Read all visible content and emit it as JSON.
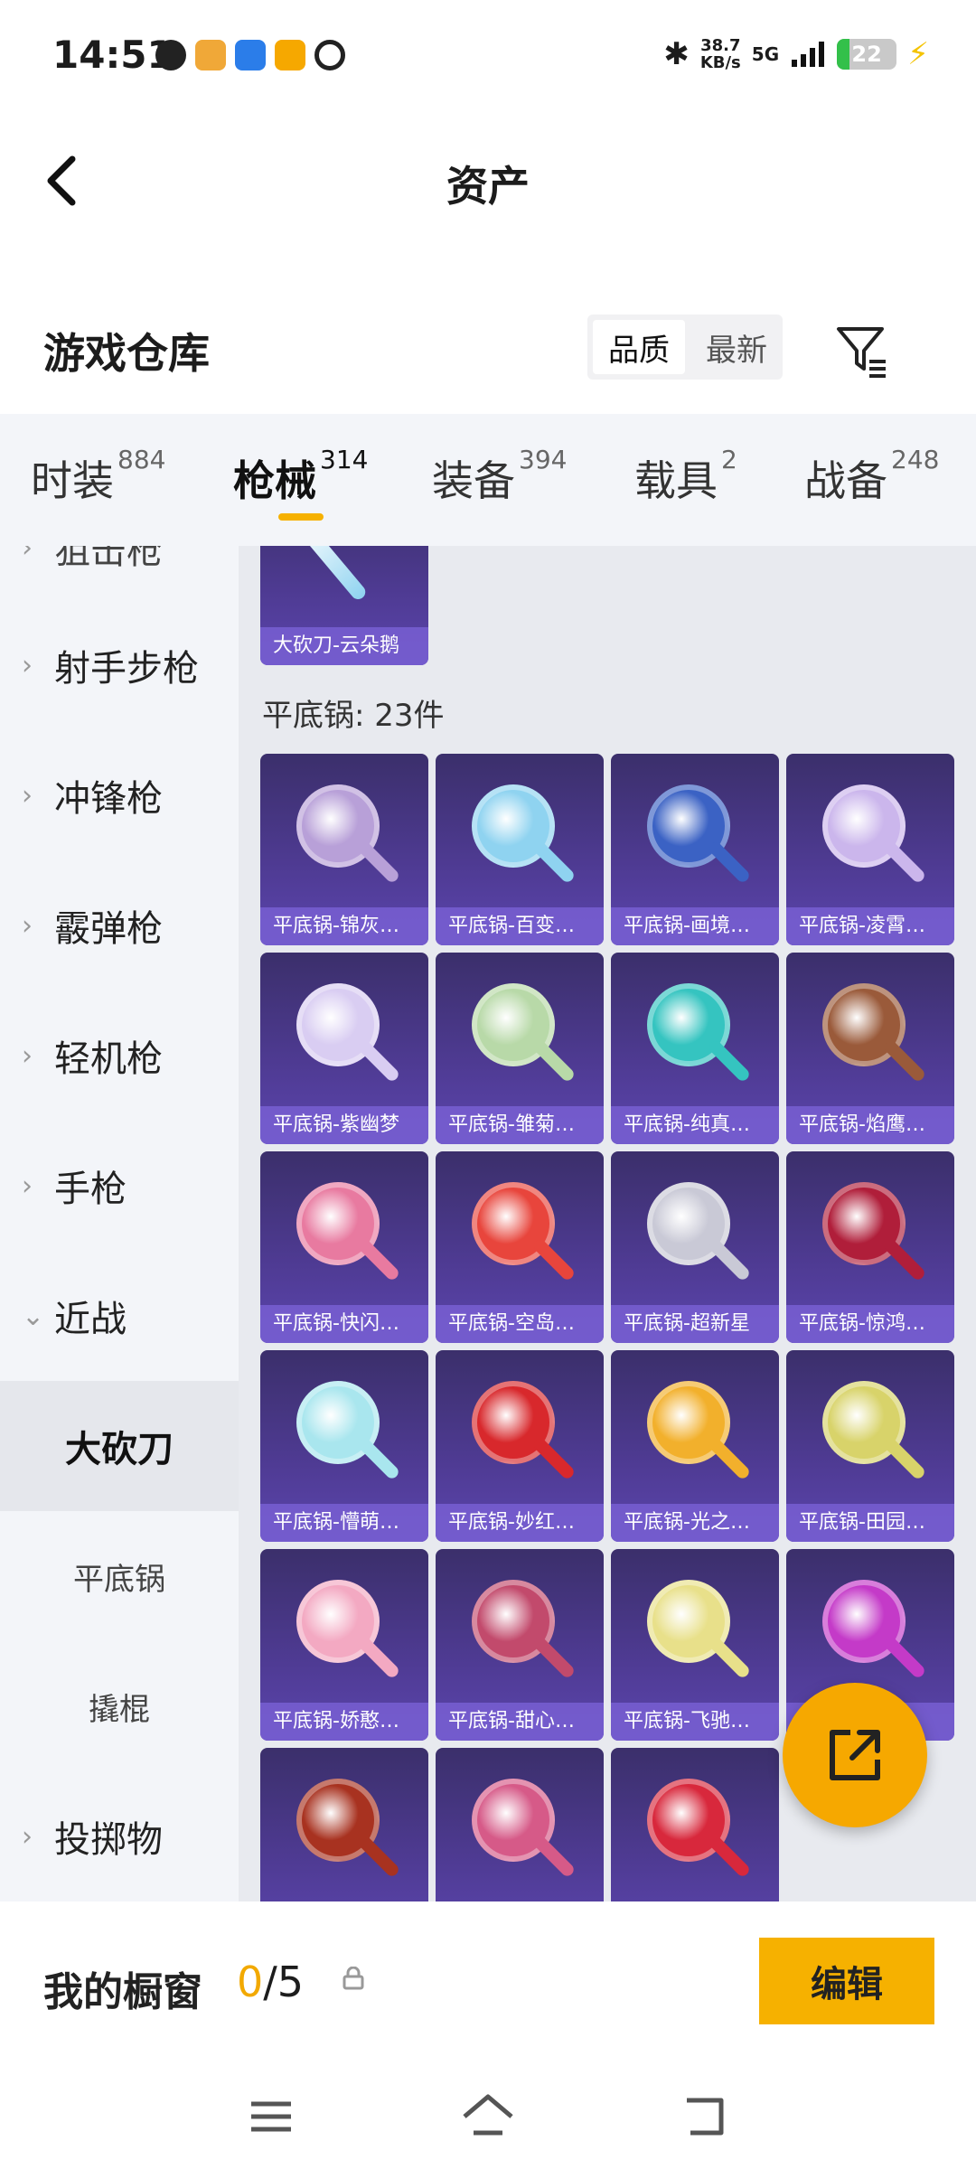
{
  "status_bar": {
    "time": "14:51",
    "net_speed_value": "38.7",
    "net_speed_unit": "KB/s",
    "network": "5G",
    "battery": "22",
    "app_icons": [
      "app-icon-1",
      "app-icon-2",
      "app-icon-3",
      "app-icon-4",
      "app-icon-5"
    ]
  },
  "header": {
    "title": "资产"
  },
  "warehouse": {
    "title": "游戏仓库",
    "sort_options": [
      "品质",
      "最新"
    ],
    "sort_selected": "品质"
  },
  "tabs": [
    {
      "label": "时装",
      "count": "884"
    },
    {
      "label": "枪械",
      "count": "314",
      "active": true
    },
    {
      "label": "装备",
      "count": "394"
    },
    {
      "label": "载具",
      "count": "2"
    },
    {
      "label": "战备",
      "count": "248"
    }
  ],
  "sidebar": {
    "items": [
      {
        "label": "射手步枪"
      },
      {
        "label": "冲锋枪"
      },
      {
        "label": "霰弹枪"
      },
      {
        "label": "轻机枪"
      },
      {
        "label": "手枪"
      },
      {
        "label": "近战",
        "expanded": true
      },
      {
        "label": "投掷物"
      }
    ],
    "sub_items": [
      {
        "label": "大砍刀",
        "selected": true
      },
      {
        "label": "平底锅"
      },
      {
        "label": "撬棍"
      }
    ],
    "partial_top": "狙击枪"
  },
  "grid": {
    "prev_item": "大砍刀-云朵鹅",
    "section_label": "平底锅: 23件",
    "items": [
      {
        "name": "平底锅-锦灰…",
        "color": "#b8a0d8"
      },
      {
        "name": "平底锅-百变…",
        "color": "#8fd3f0"
      },
      {
        "name": "平底锅-画境…",
        "color": "#3b62c4"
      },
      {
        "name": "平底锅-凌霄…",
        "color": "#cbb6ec"
      },
      {
        "name": "平底锅-紫幽梦",
        "color": "#d9cdf2"
      },
      {
        "name": "平底锅-雏菊…",
        "color": "#b8d9a8"
      },
      {
        "name": "平底锅-纯真…",
        "color": "#35c4c0"
      },
      {
        "name": "平底锅-焰鹰…",
        "color": "#9a5a3a"
      },
      {
        "name": "平底锅-快闪…",
        "color": "#e87aa0"
      },
      {
        "name": "平底锅-空岛…",
        "color": "#e8453c"
      },
      {
        "name": "平底锅-超新星",
        "color": "#c9c9d6"
      },
      {
        "name": "平底锅-惊鸿…",
        "color": "#b01e3a"
      },
      {
        "name": "平底锅-懵萌…",
        "color": "#a9e6ee"
      },
      {
        "name": "平底锅-妙红…",
        "color": "#d8282c"
      },
      {
        "name": "平底锅-光之…",
        "color": "#f2b02c"
      },
      {
        "name": "平底锅-田园…",
        "color": "#d8d36a"
      },
      {
        "name": "平底锅-娇憨…",
        "color": "#f3a9c2"
      },
      {
        "name": "平底锅-甜心…",
        "color": "#c24a6c"
      },
      {
        "name": "平底锅-飞驰…",
        "color": "#e8e08a"
      },
      {
        "name": "平底锅-…",
        "color": "#c43ac8"
      },
      {
        "name": "",
        "color": "#a83220"
      },
      {
        "name": "",
        "color": "#d65a88"
      },
      {
        "name": "",
        "color": "#d8283c"
      }
    ]
  },
  "bottom_bar": {
    "showcase_label": "我的橱窗",
    "count_current": "0",
    "count_total": "/5",
    "edit_label": "编辑"
  },
  "colors": {
    "accent": "#f6b100",
    "card_bg": "#4f3b94"
  }
}
